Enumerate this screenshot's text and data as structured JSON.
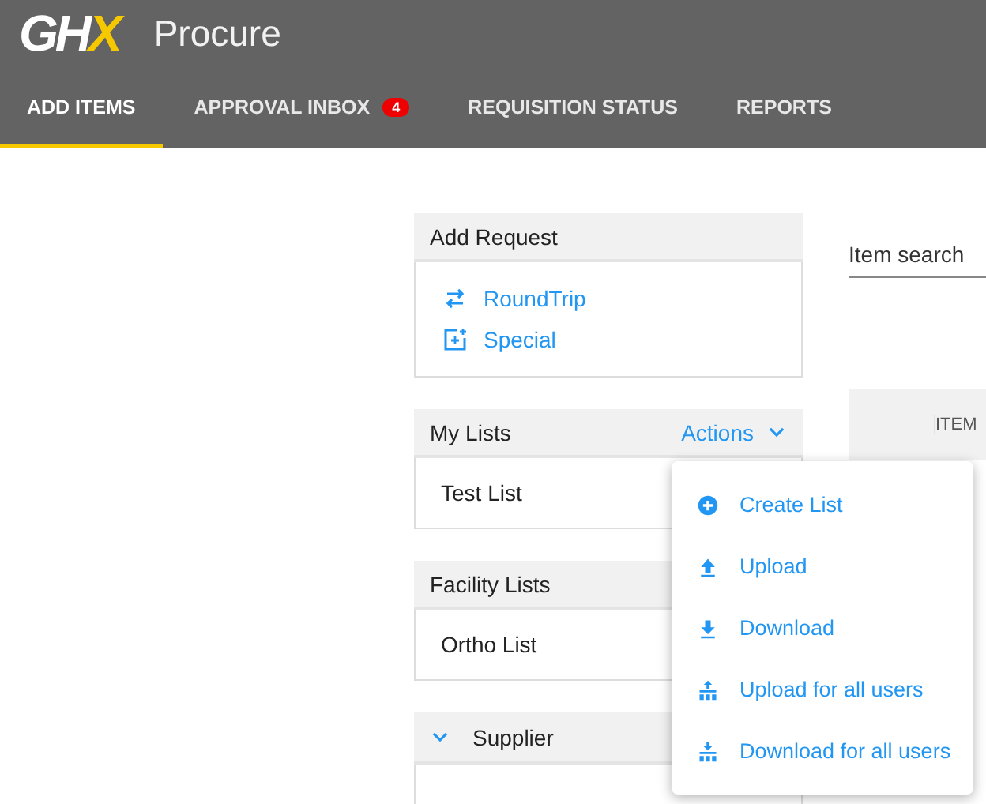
{
  "header": {
    "logo": "GHX",
    "title": "Procure"
  },
  "tabs": [
    {
      "label": "ADD ITEMS",
      "selected": true
    },
    {
      "label": "APPROVAL INBOX",
      "selected": false,
      "badge": "4"
    },
    {
      "label": "REQUISITION STATUS",
      "selected": false
    },
    {
      "label": "REPORTS",
      "selected": false
    }
  ],
  "add_request": {
    "title": "Add Request",
    "items": [
      {
        "kind": "roundtrip",
        "label": "RoundTrip"
      },
      {
        "kind": "special",
        "label": "Special"
      }
    ]
  },
  "my_lists": {
    "title": "My Lists",
    "actions": "Actions",
    "items": [
      "Test List"
    ]
  },
  "facility_lists": {
    "title": "Facility Lists",
    "items": [
      "Ortho List"
    ]
  },
  "supplier": {
    "title": "Supplier",
    "expanded": true
  },
  "search": {
    "placeholder": "Item search"
  },
  "table": {
    "columns": [
      "ITEM"
    ]
  },
  "actions_menu": [
    {
      "kind": "create",
      "label": "Create List"
    },
    {
      "kind": "upload",
      "label": "Upload"
    },
    {
      "kind": "download",
      "label": "Download"
    },
    {
      "kind": "upload_all",
      "label": "Upload for all users"
    },
    {
      "kind": "download_all",
      "label": "Download for all users"
    }
  ]
}
